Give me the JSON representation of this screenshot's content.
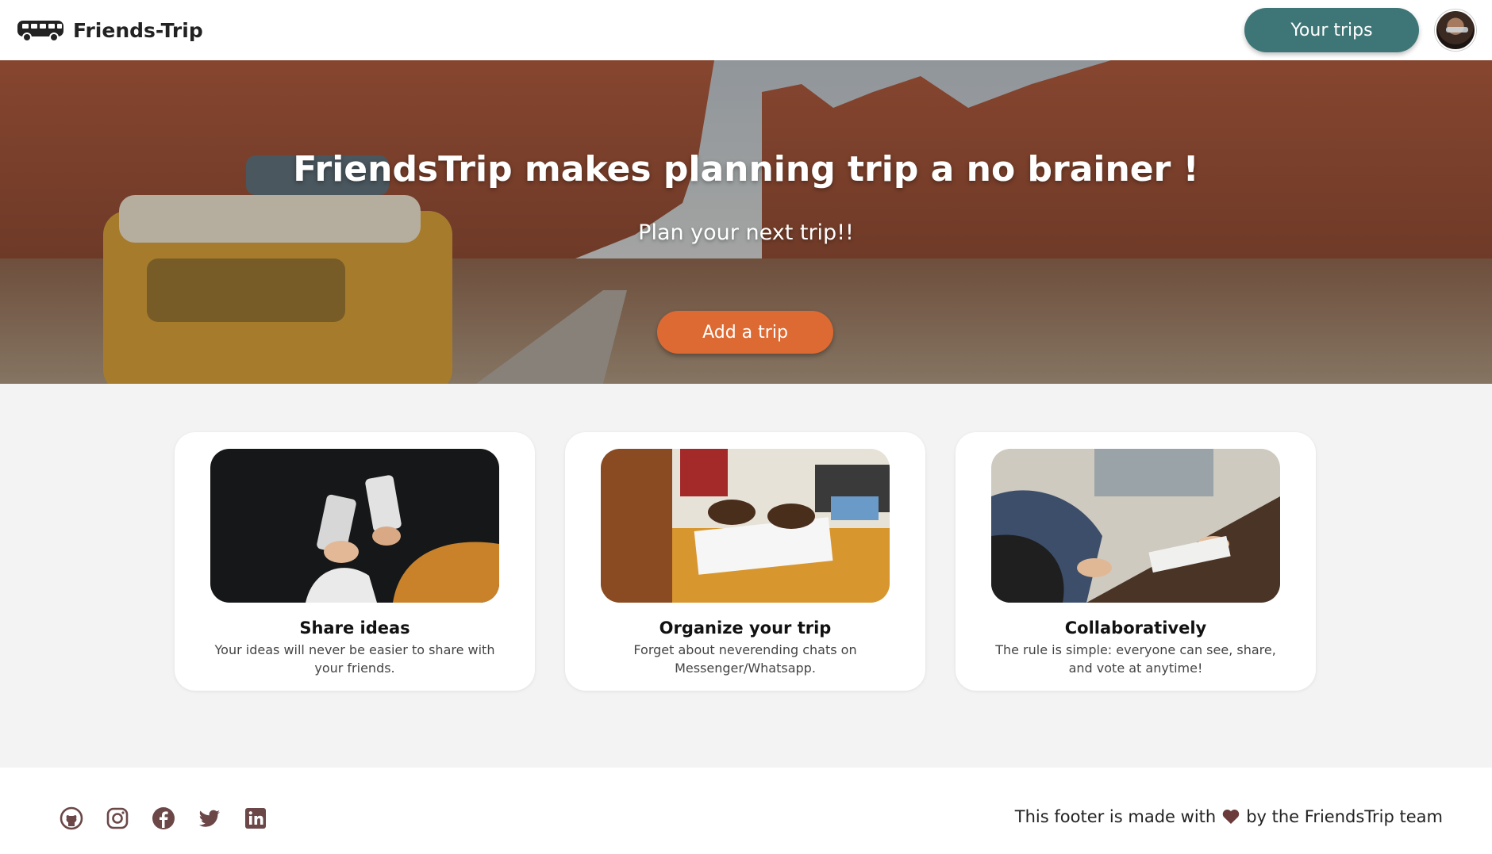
{
  "brand": {
    "name": "Friends-Trip",
    "logo_icon": "van-icon"
  },
  "nav": {
    "trips_button": "Your trips",
    "avatar_icon": "user-avatar"
  },
  "hero": {
    "title": "FriendsTrip makes planning trip a no brainer !",
    "subtitle": "Plan your next trip!!",
    "cta": "Add a trip"
  },
  "features": [
    {
      "title": "Share ideas",
      "text": "Your ideas will never be easier to share with your friends."
    },
    {
      "title": "Organize your trip",
      "text": "Forget about neverending chats on Messenger/Whatsapp."
    },
    {
      "title": "Collaboratively",
      "text": "The rule is simple: everyone can see, share, and vote at anytime!"
    }
  ],
  "footer": {
    "socials": [
      "github-icon",
      "instagram-icon",
      "facebook-icon",
      "twitter-icon",
      "linkedin-icon"
    ],
    "text_before": "This footer is made with",
    "text_after": "by the FriendsTrip team"
  },
  "colors": {
    "primary": "#3e7677",
    "accent": "#dd6a32",
    "footer_icons": "#6b4747",
    "background": "#f3f3f3"
  }
}
